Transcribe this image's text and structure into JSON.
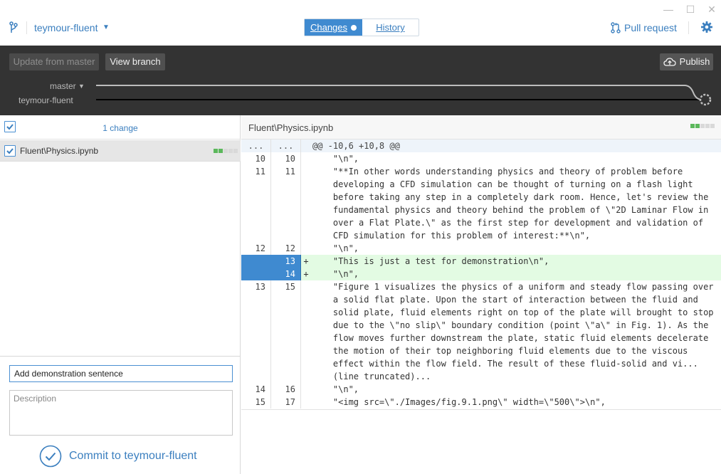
{
  "window": {
    "minimize_glyph": "—",
    "maximize_glyph": "☐",
    "close_glyph": "✕"
  },
  "header": {
    "repo_icon": "repo-branch-icon",
    "branch_name": "teymour-fluent",
    "branch_caret": "▼",
    "tabs": [
      {
        "label": "Changes",
        "active": true,
        "has_dot": true
      },
      {
        "label": "History",
        "active": false
      }
    ],
    "pull_request_label": "Pull request",
    "settings_icon": "gear-icon"
  },
  "branch_bar": {
    "update_label": "Update from master",
    "view_branch_label": "View branch",
    "publish_label": "Publish",
    "master_label": "master",
    "master_caret": "▼",
    "local_branch_label": "teymour-fluent"
  },
  "changes": {
    "count_label": "1 change",
    "files": [
      {
        "path": "Fluent\\Physics.ipynb",
        "checked": true,
        "stats": [
          "add",
          "add",
          "none",
          "none",
          "none"
        ]
      }
    ]
  },
  "commit": {
    "summary_value": "Add demonstration sentence",
    "description_placeholder": "Description",
    "button_label": "Commit to teymour-fluent"
  },
  "diff": {
    "file_path": "Fluent\\Physics.ipynb",
    "lines": [
      {
        "type": "hunk",
        "old": "...",
        "new": "...",
        "marker": "",
        "text": "@@ -10,6 +10,8 @@"
      },
      {
        "type": "context",
        "old": "10",
        "new": "10",
        "marker": "",
        "text": "    \"\\n\","
      },
      {
        "type": "context",
        "old": "11",
        "new": "11",
        "marker": "",
        "text": "    \"**In other words understanding physics and theory of problem before\n    developing a CFD simulation can be thought of turning on a flash light\n    before taking any step in a completely dark room. Hence, let's review the\n    fundamental physics and theory behind the problem of \\\"2D Laminar Flow in\n    over a Flat Plate.\\\" as the first step for development and validation of\n    CFD simulation for this problem of interest:**\\n\","
      },
      {
        "type": "context",
        "old": "12",
        "new": "12",
        "marker": "",
        "text": "    \"\\n\","
      },
      {
        "type": "added",
        "old": "",
        "new": "13",
        "marker": "+",
        "text": "    \"This is just a test for demonstration\\n\","
      },
      {
        "type": "added",
        "old": "",
        "new": "14",
        "marker": "+",
        "text": "    \"\\n\","
      },
      {
        "type": "context",
        "old": "13",
        "new": "15",
        "marker": "",
        "text": "    \"Figure 1 visualizes the physics of a uniform and steady flow passing over\n    a solid flat plate. Upon the start of interaction between the fluid and\n    solid plate, fluid elements right on top of the plate will brought to stop\n    due to the \\\"no slip\\\" boundary condition (point \\\"a\\\" in Fig. 1). As the\n    flow moves further downstream the plate, static fluid elements decelerate\n    the motion of their top neighboring fluid elements due to the viscous\n    effect within the flow field. The result of these fluid-solid and vi...\n    (line truncated)..."
      },
      {
        "type": "context",
        "old": "14",
        "new": "16",
        "marker": "",
        "text": "    \"\\n\","
      },
      {
        "type": "context",
        "old": "15",
        "new": "17",
        "marker": "",
        "text": "    \"<img src=\\\"./Images/fig.9.1.png\\\" width=\\\"500\\\">\\n\","
      }
    ]
  },
  "colors": {
    "accent": "#3f8ad0",
    "dark_bar": "#333333",
    "added_bg": "#e3fbe3",
    "stat_add": "#5cb85c",
    "stat_none": "#d9d9d9"
  }
}
